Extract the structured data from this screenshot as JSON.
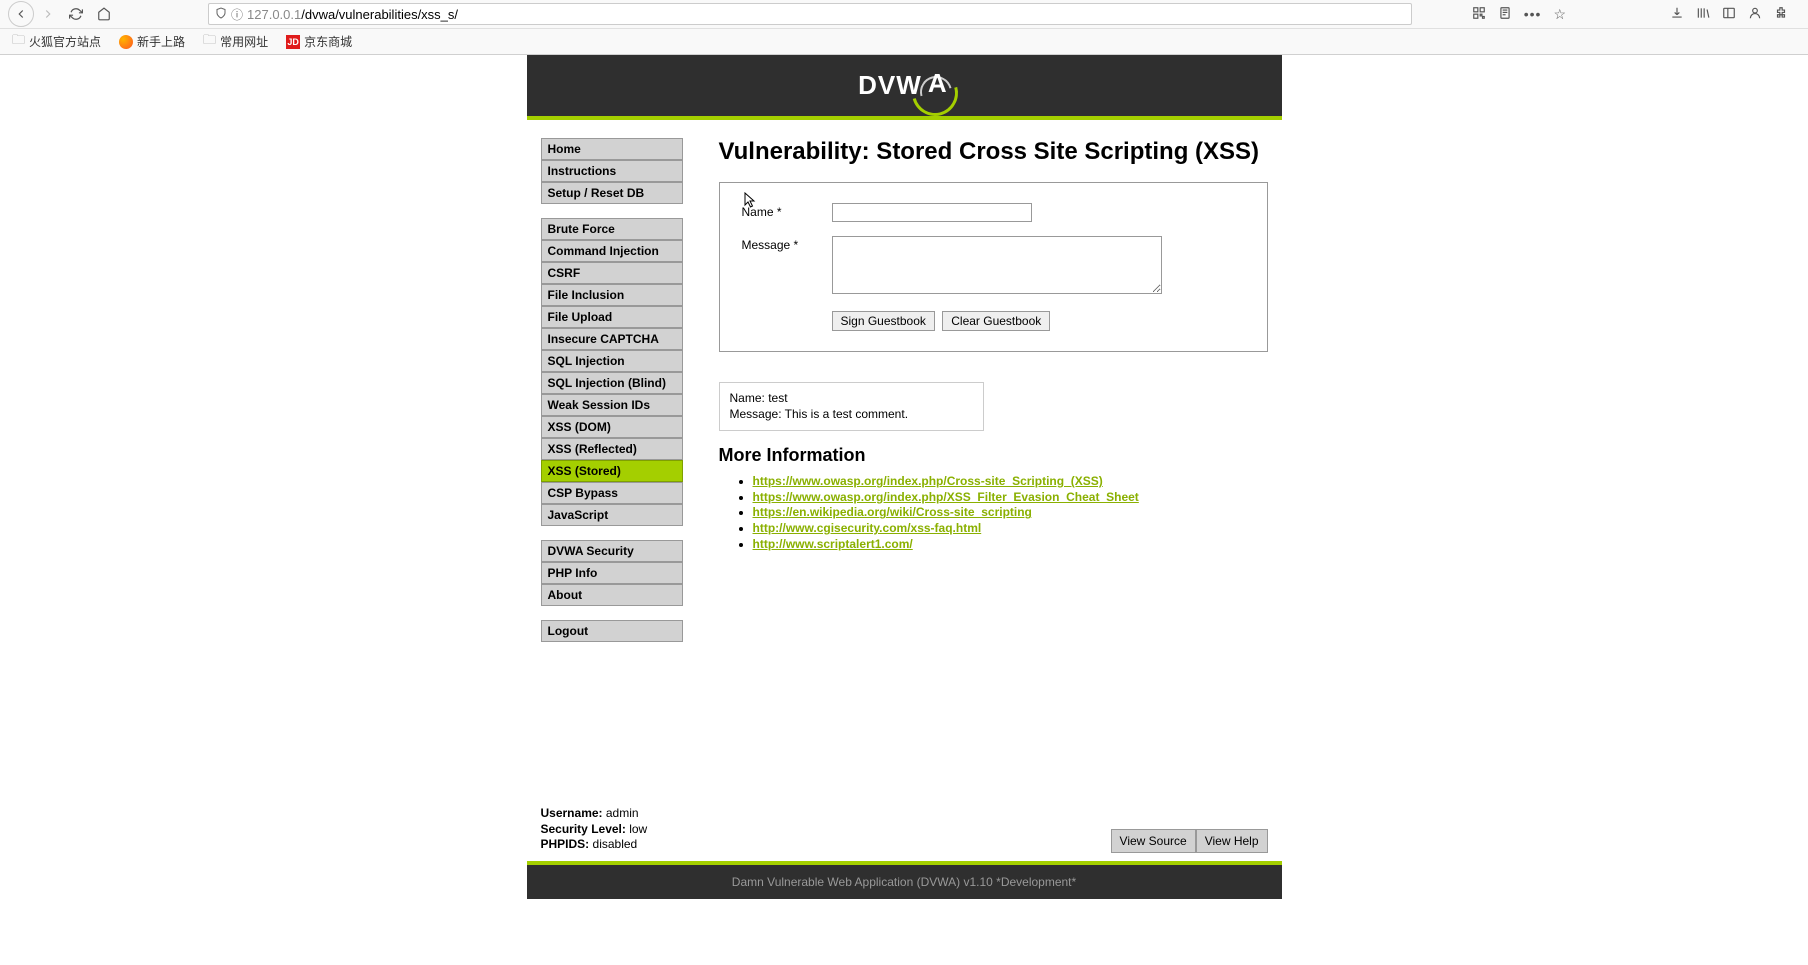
{
  "browser": {
    "url_host": "127.0.0.1",
    "url_path": "/dvwa/vulnerabilities/xss_s/",
    "bookmarks": [
      {
        "label": "火狐官方站点",
        "icon": "folder"
      },
      {
        "label": "新手上路",
        "icon": "ff"
      },
      {
        "label": "常用网址",
        "icon": "folder"
      },
      {
        "label": "京东商城",
        "icon": "jd"
      }
    ]
  },
  "sidebar": {
    "group1": [
      {
        "label": "Home"
      },
      {
        "label": "Instructions"
      },
      {
        "label": "Setup / Reset DB"
      }
    ],
    "group2": [
      {
        "label": "Brute Force"
      },
      {
        "label": "Command Injection"
      },
      {
        "label": "CSRF"
      },
      {
        "label": "File Inclusion"
      },
      {
        "label": "File Upload"
      },
      {
        "label": "Insecure CAPTCHA"
      },
      {
        "label": "SQL Injection"
      },
      {
        "label": "SQL Injection (Blind)"
      },
      {
        "label": "Weak Session IDs"
      },
      {
        "label": "XSS (DOM)"
      },
      {
        "label": "XSS (Reflected)"
      },
      {
        "label": "XSS (Stored)",
        "active": true
      },
      {
        "label": "CSP Bypass"
      },
      {
        "label": "JavaScript"
      }
    ],
    "group3": [
      {
        "label": "DVWA Security"
      },
      {
        "label": "PHP Info"
      },
      {
        "label": "About"
      }
    ],
    "group4": [
      {
        "label": "Logout"
      }
    ]
  },
  "main": {
    "title": "Vulnerability: Stored Cross Site Scripting (XSS)",
    "form": {
      "name_label": "Name *",
      "message_label": "Message *",
      "sign_button": "Sign Guestbook",
      "clear_button": "Clear Guestbook",
      "name_value": "",
      "message_value": ""
    },
    "entry": {
      "name_prefix": "Name: ",
      "name_value": "test",
      "message_prefix": "Message: ",
      "message_value": "This is a test comment."
    },
    "more_info_heading": "More Information",
    "links": [
      "https://www.owasp.org/index.php/Cross-site_Scripting_(XSS)",
      "https://www.owasp.org/index.php/XSS_Filter_Evasion_Cheat_Sheet",
      "https://en.wikipedia.org/wiki/Cross-site_scripting",
      "http://www.cgisecurity.com/xss-faq.html",
      "http://www.scriptalert1.com/"
    ]
  },
  "status": {
    "username_label": "Username:",
    "username_value": " admin",
    "security_label": "Security Level:",
    "security_value": " low",
    "phpids_label": "PHPIDS:",
    "phpids_value": " disabled"
  },
  "buttons": {
    "view_source": "View Source",
    "view_help": "View Help"
  },
  "footer": "Damn Vulnerable Web Application (DVWA) v1.10 *Development*",
  "logo_text": "DVW"
}
